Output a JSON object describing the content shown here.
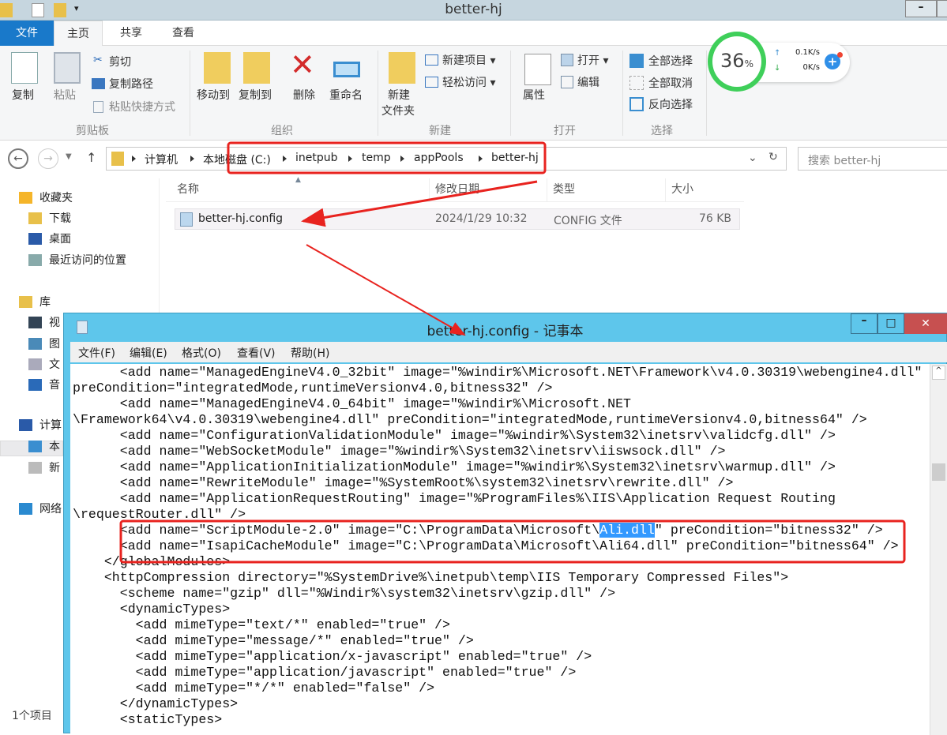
{
  "explorer": {
    "title": "better-hj",
    "tabs": [
      "文件",
      "主页",
      "共享",
      "查看"
    ],
    "ribbon": {
      "copy": "复制",
      "paste": "粘贴",
      "cut": "剪切",
      "copy_path": "复制路径",
      "paste_shortcut": "粘贴快捷方式",
      "group_clipboard": "剪贴板",
      "move_to": "移动到",
      "copy_to": "复制到",
      "delete": "删除",
      "rename": "重命名",
      "group_organize": "组织",
      "new_folder_1": "新建",
      "new_folder_2": "文件夹",
      "new_item": "新建项目",
      "easy_access": "轻松访问",
      "group_new": "新建",
      "properties": "属性",
      "open": "打开",
      "edit": "编辑",
      "group_open": "打开",
      "select_all": "全部选择",
      "select_none": "全部取消",
      "invert_selection": "反向选择",
      "group_select": "选择"
    },
    "widget": {
      "percent": "36",
      "percent_sign": "%",
      "up": "0.1K/s",
      "down": "0K/s"
    },
    "breadcrumb": [
      "计算机",
      "本地磁盘 (C:)",
      "inetpub",
      "temp",
      "appPools",
      "better-hj"
    ],
    "search_placeholder": "搜索 better-hj",
    "sidebar": [
      "收藏夹",
      "下载",
      "桌面",
      "最近访问的位置",
      "库",
      "视",
      "图",
      "文",
      "音",
      "计算",
      "本",
      "新",
      "网络"
    ],
    "columns": [
      "名称",
      "修改日期",
      "类型",
      "大小"
    ],
    "file": {
      "name": "better-hj.config",
      "date": "2024/1/29 10:32",
      "type": "CONFIG 文件",
      "size": "76 KB"
    },
    "status": "1个项目"
  },
  "notepad": {
    "title": "better-hj.config - 记事本",
    "menu": [
      "文件(F)",
      "编辑(E)",
      "格式(O)",
      "查看(V)",
      "帮助(H)"
    ],
    "lines": [
      "      <add name=\"ManagedEngineV4.0_32bit\" image=\"%windir%\\Microsoft.NET\\Framework\\v4.0.30319\\webengine4.dll\"",
      "preCondition=\"integratedMode,runtimeVersionv4.0,bitness32\" />",
      "      <add name=\"ManagedEngineV4.0_64bit\" image=\"%windir%\\Microsoft.NET",
      "\\Framework64\\v4.0.30319\\webengine4.dll\" preCondition=\"integratedMode,runtimeVersionv4.0,bitness64\" />",
      "      <add name=\"ConfigurationValidationModule\" image=\"%windir%\\System32\\inetsrv\\validcfg.dll\" />",
      "      <add name=\"WebSocketModule\" image=\"%windir%\\System32\\inetsrv\\iiswsock.dll\" />",
      "      <add name=\"ApplicationInitializationModule\" image=\"%windir%\\System32\\inetsrv\\warmup.dll\" />",
      "      <add name=\"RewriteModule\" image=\"%SystemRoot%\\system32\\inetsrv\\rewrite.dll\" />",
      "      <add name=\"ApplicationRequestRouting\" image=\"%ProgramFiles%\\IIS\\Application Request Routing",
      "\\requestRouter.dll\" />"
    ],
    "highlight_line": {
      "pre": "      <add name=\"ScriptModule-2.0\" image=\"C:\\ProgramData\\Microsoft\\",
      "selected": "Ali.dll",
      "post": "\" preCondition=\"bitness32\" />"
    },
    "lines2": [
      "      <add name=\"IsapiCacheModule\" image=\"C:\\ProgramData\\Microsoft\\Ali64.dll\" preCondition=\"bitness64\" />",
      "    </globalModules>",
      "    <httpCompression directory=\"%SystemDrive%\\inetpub\\temp\\IIS Temporary Compressed Files\">",
      "      <scheme name=\"gzip\" dll=\"%Windir%\\system32\\inetsrv\\gzip.dll\" />",
      "      <dynamicTypes>",
      "        <add mimeType=\"text/*\" enabled=\"true\" />",
      "        <add mimeType=\"message/*\" enabled=\"true\" />",
      "        <add mimeType=\"application/x-javascript\" enabled=\"true\" />",
      "        <add mimeType=\"application/javascript\" enabled=\"true\" />",
      "        <add mimeType=\"*/*\" enabled=\"false\" />",
      "      </dynamicTypes>",
      "      <staticTypes>"
    ]
  },
  "colors": {
    "annotation": "#e8231f",
    "notepad_title": "#5ec6eb",
    "file_tab": "#1979ca",
    "selection": "#3399ff",
    "widget_ring": "#3fcf5a"
  }
}
